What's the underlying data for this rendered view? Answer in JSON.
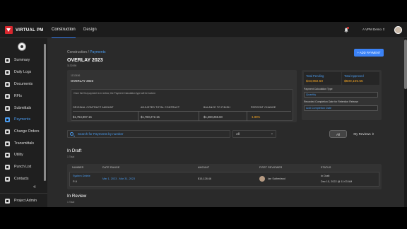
{
  "header": {
    "logo_text": "VIRTUAL PM",
    "tabs": [
      {
        "label": "Construction",
        "active": true
      },
      {
        "label": "Design",
        "active": false
      }
    ],
    "user_name": "A VPM Demo"
  },
  "sidebar": {
    "items": [
      {
        "label": "Summary",
        "icon": "summary-icon"
      },
      {
        "label": "Daily Logs",
        "icon": "daily-logs-icon"
      },
      {
        "label": "Documents",
        "icon": "documents-icon"
      },
      {
        "label": "RFIs",
        "icon": "rfis-icon"
      },
      {
        "label": "Submittals",
        "icon": "submittals-icon"
      },
      {
        "label": "Payments",
        "icon": "payments-icon",
        "active": true
      },
      {
        "label": "Change Orders",
        "icon": "change-orders-icon"
      },
      {
        "label": "Transmittals",
        "icon": "transmittals-icon"
      },
      {
        "label": "Utility",
        "icon": "utility-icon"
      },
      {
        "label": "Punch List",
        "icon": "punch-list-icon"
      },
      {
        "label": "Contacts",
        "icon": "contacts-icon"
      }
    ],
    "collapse_glyph": "«",
    "admin_label": "Project Admin"
  },
  "main": {
    "breadcrumb_root": "Construction",
    "breadcrumb_sep": " / ",
    "breadcrumb_current": "Payments",
    "title": "OVERLAY 2023",
    "subtitle": "1132456",
    "add_button": "+ ADD PAYMENT",
    "card": {
      "sub": "1132456",
      "title": "OVERLAY 2023",
      "note": "Once the first payment is in review, the Payment Calculation type will be locked.",
      "metrics": [
        {
          "label": "ORIGINAL CONTRACT AMOUNT",
          "value": "$1,754,897.15"
        },
        {
          "label": "ADJUSTED TOTAL CONTRACT",
          "value": "$1,760,272.15"
        },
        {
          "label": "BALANCE TO FINISH",
          "value": "$1,260,266.60"
        },
        {
          "label": "PERCENT CHANGE",
          "value": "-1.86%"
        }
      ]
    },
    "side_panel": {
      "pending_label": "Total Pending",
      "pending_value": "$43,892.50",
      "approved_label": "Total Approved",
      "approved_value": "$500,105.55",
      "calc_type_label": "Payment Calculation Type",
      "calc_type_value": "Quantity",
      "retention_label": "Recorded Completion Date for Retention Release",
      "retention_value": "Add Completion Date"
    },
    "search_placeholder": "Search for Payments by number",
    "filter_value": "All",
    "filter_chevron": "⌄",
    "toggle_all": "All",
    "toggle_my_reviews": "My Reviews",
    "draft_title": "In Draft",
    "draft_count": "1 Total",
    "table": {
      "headers": [
        "NUMBER",
        "DATE RANGE",
        "AMOUNT",
        "FIRST REVIEWER",
        "STATUS"
      ],
      "rows": [
        {
          "number_title": "System Delete",
          "number_sub": "P-9",
          "date_range": "Mar 1, 2023 - Mar 31, 2023",
          "amount": "$15,128.46",
          "reviewer": "Ian Sutherland",
          "status": "In Draft",
          "status_date": "Dec 15, 2022 @ 11:03 AM"
        }
      ]
    },
    "review_title": "In Review",
    "review_count": "1 Total"
  }
}
